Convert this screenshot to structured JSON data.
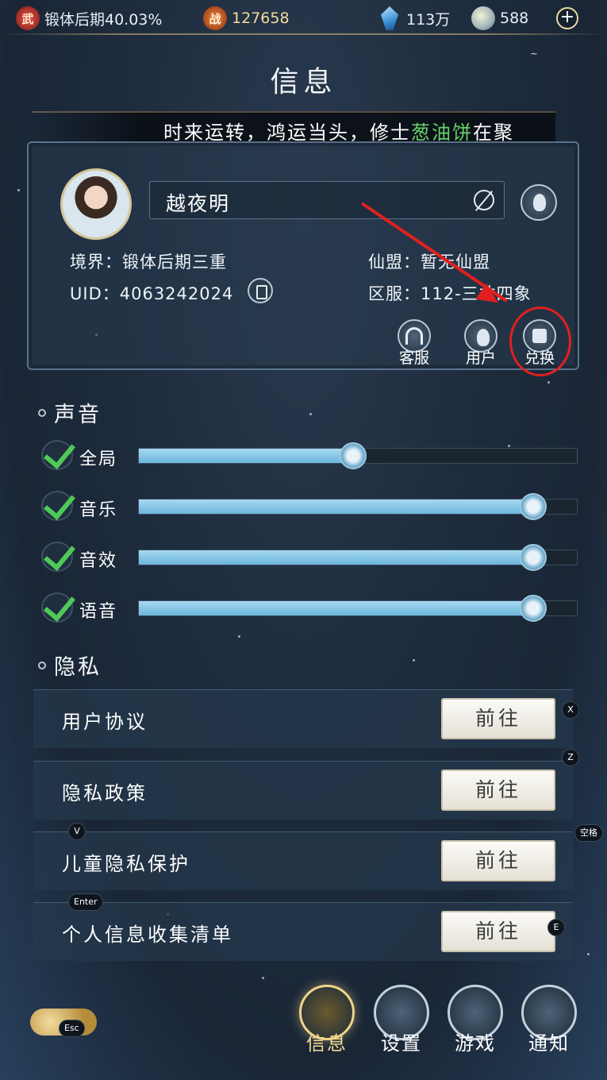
{
  "topbar": {
    "realm_badge": "武",
    "realm_progress": "锻体后期40.03%",
    "power_badge": "战",
    "power_value": "127658",
    "gems": "113万",
    "coins": "588",
    "add_label": "+"
  },
  "page_title": "信息",
  "marquee": {
    "text_before": "时来运转，鸿运当头，修士",
    "highlight": "葱油饼",
    "text_after": "在聚"
  },
  "profile": {
    "name": "越夜明",
    "realm_label": "境界：锻体后期三重",
    "uid_label": "UID：4063242024",
    "alliance_label": "仙盟：暂无仙盟",
    "server_label": "区服：112-三才四象",
    "actions": [
      {
        "label": "客服",
        "icon": "headset-icon"
      },
      {
        "label": "用户",
        "icon": "user-icon"
      },
      {
        "label": "兑换",
        "icon": "gift-icon"
      }
    ]
  },
  "sound": {
    "title": "声音",
    "sliders": [
      {
        "label": "全局",
        "value": 0.49,
        "checked": true
      },
      {
        "label": "音乐",
        "value": 0.9,
        "checked": true
      },
      {
        "label": "音效",
        "value": 0.9,
        "checked": true
      },
      {
        "label": "语音",
        "value": 0.9,
        "checked": true
      }
    ]
  },
  "privacy": {
    "title": "隐私",
    "rows": [
      {
        "label": "用户协议",
        "button": "前往"
      },
      {
        "label": "隐私政策",
        "button": "前往"
      },
      {
        "label": "儿童隐私保护",
        "button": "前往"
      },
      {
        "label": "个人信息收集清单",
        "button": "前往"
      }
    ]
  },
  "key_hints": {
    "x": "X",
    "z": "Z",
    "v": "V",
    "space": "空格",
    "enter": "Enter",
    "e": "E",
    "esc": "Esc",
    "tilde": "~"
  },
  "bottom_nav": [
    {
      "label": "信息",
      "active": true
    },
    {
      "label": "设置",
      "active": false
    },
    {
      "label": "游戏",
      "active": false
    },
    {
      "label": "通知",
      "active": false
    }
  ],
  "colors": {
    "accent_gold": "#f3d98e",
    "check_green": "#4fc957",
    "annotation_red": "#e02020"
  }
}
